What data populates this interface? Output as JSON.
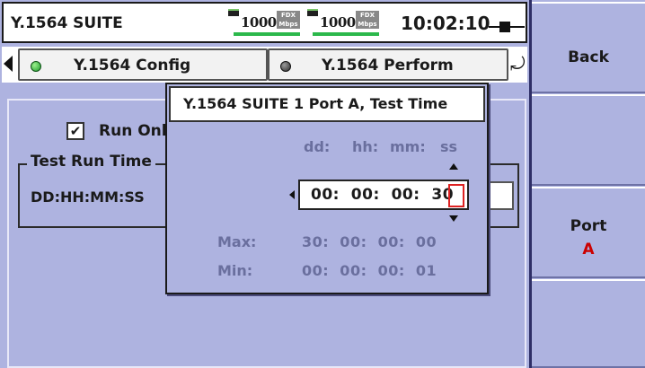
{
  "app_title": "Y.1564 SUITE",
  "status": {
    "port1_speed": "1000",
    "port1_duplex": "FDX",
    "port1_unit": "Mbps",
    "port2_speed": "1000",
    "port2_duplex": "FDX",
    "port2_unit": "Mbps",
    "clock": "10:02:10",
    "link_color": "#2bb84b"
  },
  "tabs": [
    {
      "label": "Y.1564 Config",
      "status": "green-dot-icon"
    },
    {
      "label": "Y.1564 Perform",
      "status": "gray-dot-icon"
    }
  ],
  "main": {
    "run_only_label": "Run Onl",
    "run_only_checked": true,
    "group_title": "Test Run Time",
    "duration_label": "DD:HH:MM:SS"
  },
  "softkeys": {
    "back": "Back",
    "port_label": "Port",
    "port_value": "A",
    "port_value_color": "#cc0000"
  },
  "popup": {
    "title": "Y.1564 SUITE 1 Port A, Test Time",
    "columns": [
      "dd:",
      "hh:",
      "mm:",
      "ss"
    ],
    "value": "00:  00:  00:  30",
    "max_label": "Max:",
    "max_value": "30:  00:  00:  00",
    "min_label": "Min:",
    "min_value": "00:  00:  00:  01",
    "cursor_color": "#dd2222"
  }
}
